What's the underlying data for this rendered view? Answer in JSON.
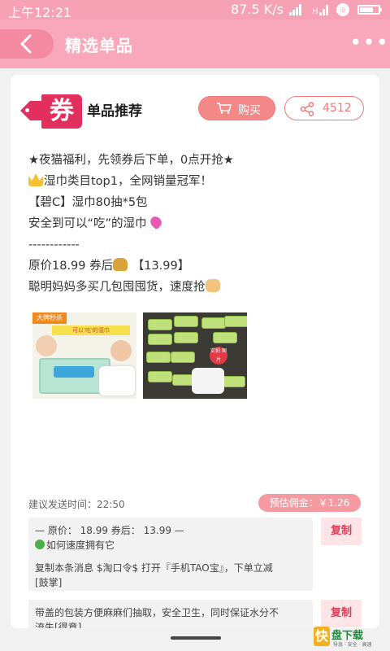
{
  "status_bar": {
    "time": "上午12:21",
    "net_speed": "87.5 K/s"
  },
  "header": {
    "title": "精选单品",
    "back_icon": "chevron-left-icon",
    "more_icon": "more-dots-icon",
    "color": "#f9a7bb"
  },
  "card": {
    "logo_text": "券",
    "title": "单品推荐",
    "buy_label": "购买",
    "share_count": "4512",
    "desc_lines": [
      {
        "emoji": "",
        "text": "★夜猫福利，先领券后下单，0点开抢★"
      },
      {
        "emoji": "crown",
        "text": "湿巾类目top1，全网销量冠军！"
      },
      {
        "emoji": "",
        "text": "【碧C】湿巾80抽*5包"
      },
      {
        "emoji": "heart-end",
        "text": "安全到可以“吃”的湿巾"
      },
      {
        "emoji": "",
        "text": "------------"
      },
      {
        "emoji": "bag-mid",
        "text_before": "原价18.99 券后",
        "text_after": "【13.99】"
      },
      {
        "emoji": "fist-end",
        "text": "聪明妈妈多买几包囤囤货，速度抢"
      }
    ],
    "images": {
      "img1_badge": "大牌秒杀",
      "img1_banner": "可以'吃'的湿巾",
      "img2_stamp": "实拍\n图片"
    },
    "send_time": "建议发送时间：22:50",
    "commission": "预估佣金：￥1.26",
    "copy_blocks": [
      {
        "lines": [
          "— 原价： 18.99 券后： 13.99 —",
          "如何速度拥有它",
          "",
          "复制本条消息 $淘口令$ 打开『手机TAO宝』，下单立减",
          "[鼓掌]"
        ],
        "button": "复制"
      },
      {
        "lines": [
          "带盖的包装方便麻麻们抽取，安全卫生，同时保证水分不",
          "流失[得意]"
        ],
        "button": "复制"
      }
    ]
  },
  "watermark": {
    "logo": "快",
    "title": "盘下载",
    "slogan": "导急 · 安全 · 高速"
  },
  "colors": {
    "accent": "#f48888",
    "brand_red": "#e32f5e",
    "copy_red": "#e23b55"
  }
}
